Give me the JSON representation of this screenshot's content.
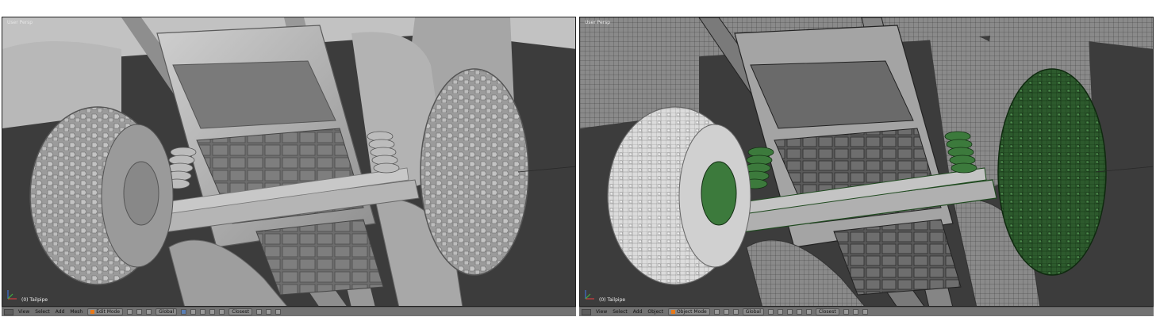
{
  "viewports": [
    {
      "label": "User Persp",
      "object_label": "(0) Tailpipe",
      "shading": "solid"
    },
    {
      "label": "User Persp",
      "object_label": "(0) Tailpipe",
      "shading": "wireframe"
    }
  ],
  "headers": [
    {
      "menus": [
        "View",
        "Select",
        "Add",
        "Mesh"
      ],
      "mode": "Edit Mode",
      "orientation": "Global",
      "proportional": "Closest"
    },
    {
      "menus": [
        "View",
        "Select",
        "Add",
        "Object"
      ],
      "mode": "Object Mode",
      "orientation": "Global",
      "proportional": "Closest"
    }
  ],
  "colors": {
    "viewport_bg": "#3c3c3c",
    "header_bg": "#727272",
    "model_solid": "#a9a9a9",
    "wire_selected": "#2f6b2f",
    "mode_edit": "#e87a1a",
    "mode_object": "#e87a1a"
  },
  "icons": [
    "editor-type-icon",
    "mode-icon",
    "viewport-shading-icon",
    "pivot-icon",
    "manipulator-icon",
    "layer-icon",
    "snap-icon",
    "render-icon",
    "axis-gizmo-icon"
  ]
}
